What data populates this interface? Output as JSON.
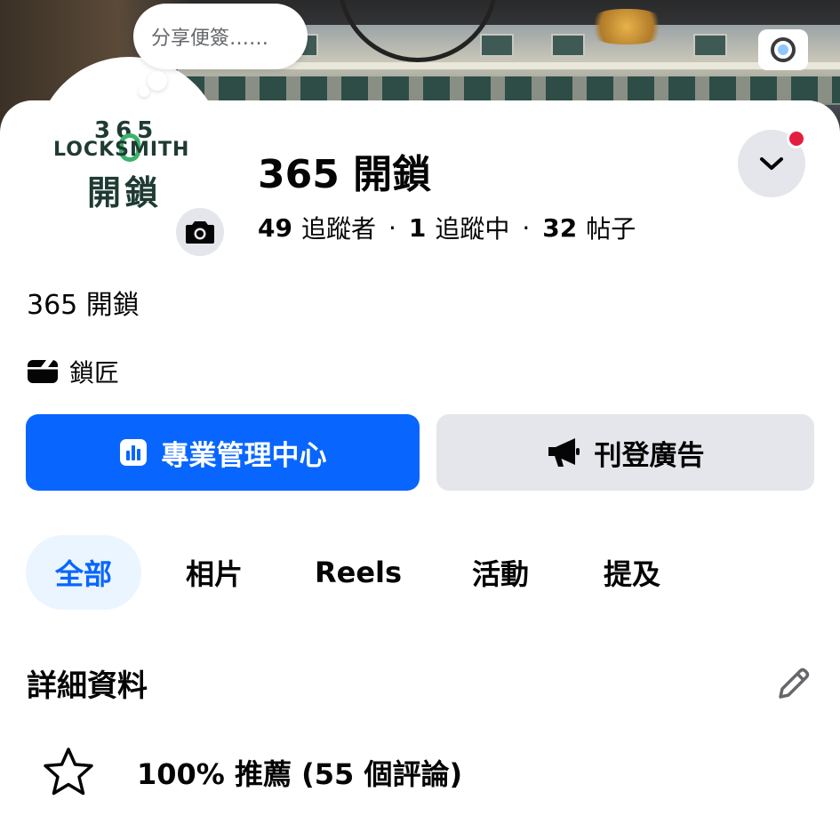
{
  "note": {
    "text": "分享便簽……"
  },
  "logo": {
    "number": "365",
    "word": "LOCKSMITH",
    "chinese": "開鎖"
  },
  "profile": {
    "name": "365 開鎖",
    "followers_count": "49",
    "followers_label": "追蹤者",
    "following_count": "1",
    "following_label": "追蹤中",
    "posts_count": "32",
    "posts_label": "帖子",
    "separator": "·",
    "bio": "365 開鎖",
    "category": "鎖匠"
  },
  "buttons": {
    "professional_dashboard": "專業管理中心",
    "advertise": "刊登廣告"
  },
  "tabs": [
    {
      "label": "全部",
      "active": true
    },
    {
      "label": "相片",
      "active": false
    },
    {
      "label": "Reels",
      "active": false
    },
    {
      "label": "活動",
      "active": false
    },
    {
      "label": "提及",
      "active": false
    }
  ],
  "details": {
    "title": "詳細資料",
    "recommendation": "100% 推薦 (55 個評論)"
  },
  "colors": {
    "primary": "#0866ff",
    "secondary_bg": "#e4e6eb",
    "active_tab_bg": "#ebf5ff",
    "notification_dot": "#e41e3f",
    "logo_green": "#3bb36a",
    "logo_dark": "#1f3b33"
  },
  "icons": {
    "cover_camera": "camera-icon",
    "avatar_camera": "camera-icon",
    "dropdown": "chevron-down-icon",
    "category": "clapperboard-icon",
    "dashboard": "bar-chart-icon",
    "advertise": "megaphone-icon",
    "edit": "pencil-icon",
    "recommendation": "star-outline-icon"
  }
}
